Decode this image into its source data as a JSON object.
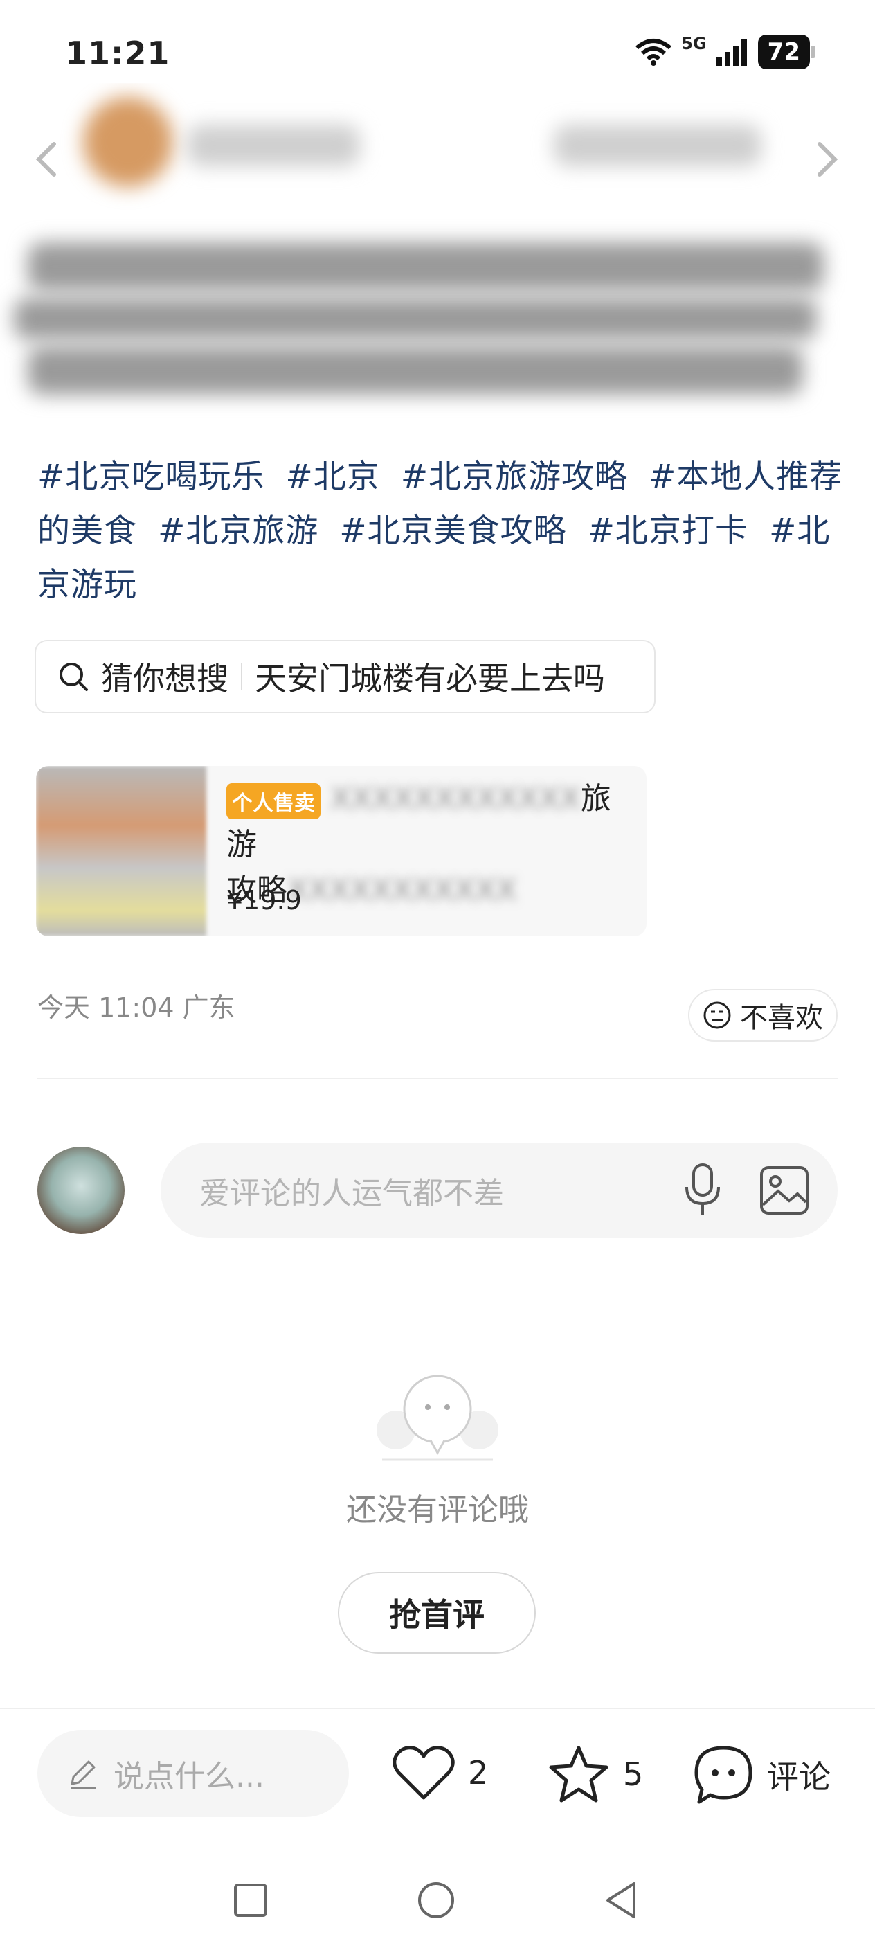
{
  "status_bar": {
    "time": "11:21",
    "network": "5G",
    "battery": "72"
  },
  "hashtags": [
    "#北京吃喝玩乐",
    "#北京",
    "#北京旅游攻略",
    "#本地人推荐的美食",
    "#北京旅游",
    "#北京美食攻略",
    "#北京打卡",
    "#北京游玩"
  ],
  "search_suggest": {
    "label": "猜你想搜",
    "query": "天安门城楼有必要上去吗"
  },
  "product": {
    "badge": "个人售卖",
    "title_visible_end": "旅游",
    "title_line2_start": "攻略",
    "price": "¥19.9"
  },
  "meta": {
    "time_location": "今天 11:04 广东",
    "dislike_label": "不喜欢"
  },
  "comment": {
    "placeholder": "爱评论的人运气都不差"
  },
  "empty_state": {
    "text": "还没有评论哦",
    "button_label": "抢首评"
  },
  "bottom_bar": {
    "say_placeholder": "说点什么...",
    "like_count": "2",
    "favorite_count": "5",
    "comment_label": "评论"
  },
  "icons": {
    "back": "back-arrow-icon",
    "share": "share-icon",
    "search": "search-icon",
    "dislike": "neutral-face-icon",
    "mic": "mic-icon",
    "image": "image-icon",
    "pen": "pen-icon",
    "heart": "heart-icon",
    "star": "star-icon",
    "comment": "speech-bubble-icon"
  },
  "colors": {
    "hashtag": "#1e3a66",
    "badge": "#f5a623",
    "muted_text": "#888888"
  }
}
